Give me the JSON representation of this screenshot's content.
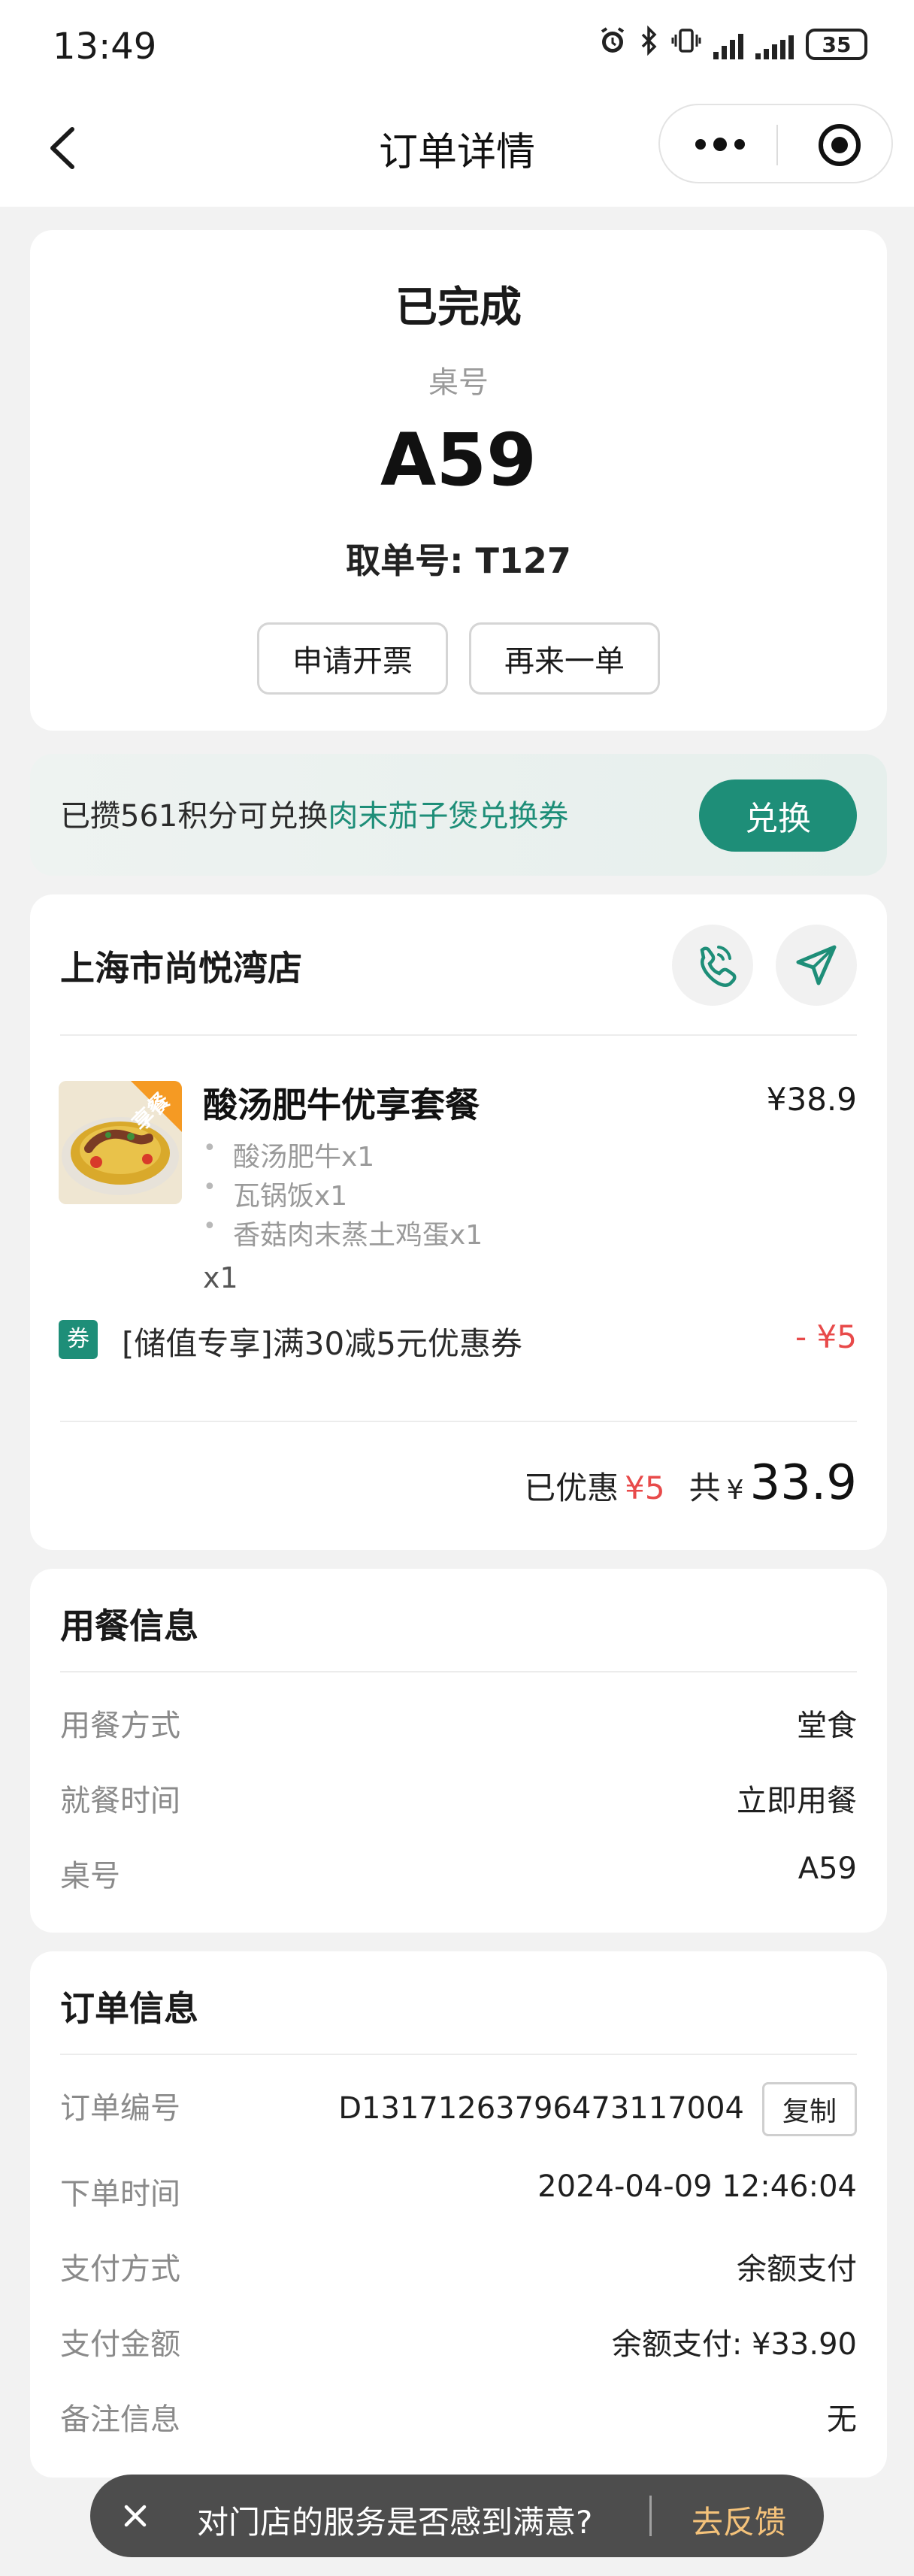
{
  "status_bar": {
    "time": "13:49",
    "battery": "35",
    "icons": [
      "alarm-icon",
      "bluetooth-icon",
      "vibrate-icon",
      "signal-icon",
      "signal-icon-2",
      "battery-icon"
    ]
  },
  "nav": {
    "title": "订单详情",
    "back_icon": "chevron-left-icon",
    "more_icon": "more-dots-icon",
    "close_icon": "target-icon"
  },
  "status_card": {
    "status": "已完成",
    "table_label": "桌号",
    "table_number": "A59",
    "pickup_label": "取单号: T127",
    "buttons": [
      "申请开票",
      "再来一单"
    ]
  },
  "points_banner": {
    "text_prefix": "已攒561积分可兑换",
    "text_highlight": "肉末茄子煲兑换券",
    "button": "兑换"
  },
  "store_card": {
    "store_name": "上海市尚悦湾店",
    "phone_icon": "phone-icon",
    "nav_icon": "navigation-arrow-icon",
    "item": {
      "name": "酸汤肥牛优享套餐",
      "badge": "享餐",
      "price": "¥38.9",
      "sub_items": [
        "酸汤肥牛x1",
        "瓦锅饭x1",
        "香菇肉末蒸土鸡蛋x1"
      ],
      "quantity": "x1"
    },
    "coupon": {
      "tag": "券",
      "text": "[储值专享]满30减5元优惠券",
      "amount": "- ¥5"
    },
    "summary": {
      "discount_label": "已优惠",
      "discount_value": "¥5",
      "total_label": "共",
      "total_currency": "¥",
      "total_value": "33.9"
    }
  },
  "dining_info": {
    "title": "用餐信息",
    "rows": [
      {
        "label": "用餐方式",
        "value": "堂食"
      },
      {
        "label": "就餐时间",
        "value": "立即用餐"
      },
      {
        "label": "桌号",
        "value": "A59"
      }
    ]
  },
  "order_info": {
    "title": "订单信息",
    "copy_button": "复制",
    "rows": [
      {
        "label": "订单编号",
        "value": "D1317126379647311700​4"
      },
      {
        "label": "下单时间",
        "value": "2024-04-09 12:46:04"
      },
      {
        "label": "支付方式",
        "value": "余额支付"
      },
      {
        "label": "支付金额",
        "value": "余额支付: ¥33.90"
      },
      {
        "label": "备注信息",
        "value": "无"
      }
    ]
  },
  "toast": {
    "close_icon": "close-icon",
    "text": "对门店的服务是否感到满意?",
    "action": "去反馈"
  },
  "colors": {
    "accent_green": "#1e8e78",
    "price_red": "#e84a4a",
    "orange": "#f59a23",
    "toast_action": "#f4c27a"
  }
}
